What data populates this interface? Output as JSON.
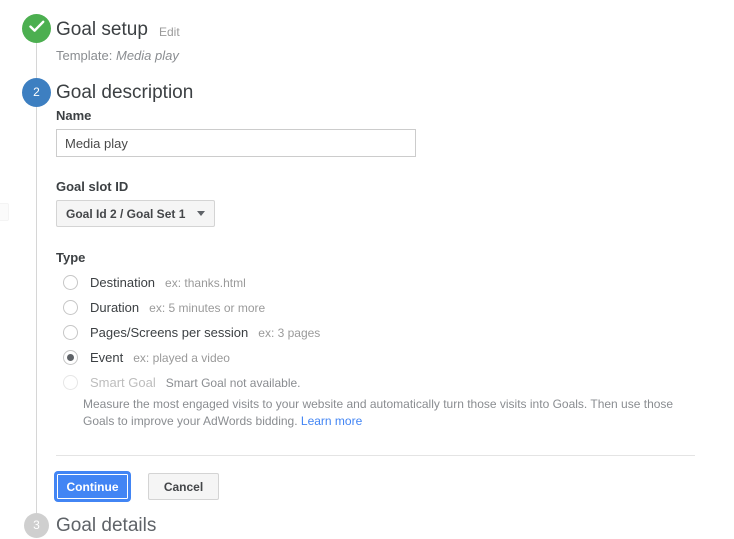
{
  "steps": {
    "step1": {
      "marker": "check-icon",
      "title": "Goal setup",
      "edit_label": "Edit",
      "template_prefix": "Template:",
      "template_value": "Media play"
    },
    "step2": {
      "marker": "2",
      "title": "Goal description",
      "name_label": "Name",
      "name_value": "Media play",
      "name_placeholder": "",
      "slot_label": "Goal slot ID",
      "slot_value": "Goal Id 2 / Goal Set 1",
      "type_label": "Type"
    },
    "step3": {
      "marker": "3",
      "title": "Goal details"
    }
  },
  "type_options": [
    {
      "label": "Destination",
      "example": "ex: thanks.html",
      "checked": false,
      "disabled": false
    },
    {
      "label": "Duration",
      "example": "ex: 5 minutes or more",
      "checked": false,
      "disabled": false
    },
    {
      "label": "Pages/Screens per session",
      "example": "ex: 3 pages",
      "checked": false,
      "disabled": false
    },
    {
      "label": "Event",
      "example": "ex: played a video",
      "checked": true,
      "disabled": false
    },
    {
      "label": "Smart Goal",
      "example": "Smart Goal not available.",
      "checked": false,
      "disabled": true
    }
  ],
  "smart_goal": {
    "description": "Measure the most engaged visits to your website and automatically turn those visits into Goals. Then use those Goals to improve your AdWords bidding.",
    "learn_more": "Learn more"
  },
  "actions": {
    "continue_label": "Continue",
    "cancel_label": "Cancel"
  },
  "colors": {
    "primary": "#4285f4",
    "done": "#4caf50",
    "active_step": "#3d7fc1",
    "pending_step": "#cfcfcf",
    "link": "#4285f4"
  }
}
